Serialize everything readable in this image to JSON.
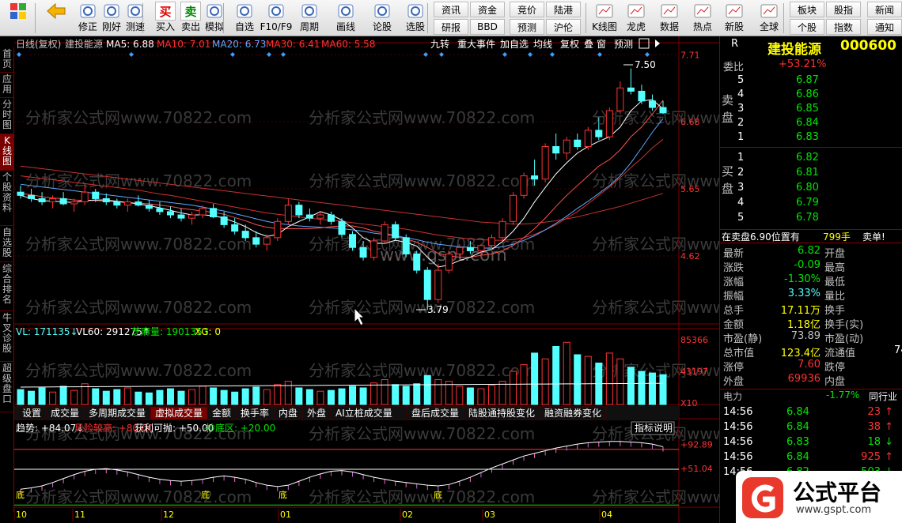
{
  "colors": {
    "up": "#ff3232",
    "down": "#54ffff",
    "white": "#ffffff",
    "yellow": "#ffff00",
    "green": "#00e600",
    "pink": "#ff66cc",
    "grid": "#800000",
    "label": "#c0c0c0",
    "title": "#ffff00"
  },
  "toolbar": [
    {
      "icon": "windows-grid-icon",
      "label": ""
    },
    {
      "icon": "back-arrow-icon",
      "label": ""
    },
    {
      "icon": "adjust-icon",
      "label": "修正"
    },
    {
      "icon": "power-icon",
      "label": "刚好"
    },
    {
      "icon": "stopwatch-icon",
      "label": "测速"
    },
    {
      "icon": "buy-icon",
      "glyph": "买",
      "label": "买入"
    },
    {
      "icon": "sell-icon",
      "glyph": "卖",
      "label": "卖出"
    },
    {
      "icon": "hammer-icon",
      "label": "模拟"
    },
    {
      "icon": "watchlist-icon",
      "label": "自选"
    },
    {
      "icon": "f10-icon",
      "label": "F10/F9"
    },
    {
      "icon": "cycle-icon",
      "label": "周期"
    },
    {
      "icon": "pen-icon",
      "label": "画线"
    },
    {
      "icon": "discuss-icon",
      "label": "论股"
    },
    {
      "icon": "select-stock-icon",
      "label": "选股"
    }
  ],
  "toolbar_grid1": [
    "资讯",
    "资金",
    "研报",
    "BBD"
  ],
  "toolbar_grid2": [
    "竞价",
    "陆港",
    "预测",
    "沪伦"
  ],
  "toolbar2": [
    {
      "icon": "kline-icon",
      "label": "K线图"
    },
    {
      "icon": "dragon-tiger-icon",
      "label": "龙虎"
    },
    {
      "icon": "pe-icon",
      "label": "数据"
    },
    {
      "icon": "hot-icon",
      "label": "热点"
    },
    {
      "icon": "new-stock-icon",
      "label": "新股"
    },
    {
      "icon": "globe-icon",
      "label": "全球"
    }
  ],
  "toolbar_grid3": [
    "板块",
    "股指",
    "个股",
    "指数"
  ],
  "toolbar_grid4": [
    "新闻",
    "通知"
  ],
  "sidebar": [
    {
      "label": "首页",
      "active": false
    },
    {
      "label": "应用",
      "active": false
    },
    {
      "label": "分时图",
      "active": false
    },
    {
      "label": "K线图",
      "active": true
    },
    {
      "label": "个股资料",
      "active": false
    },
    {
      "label": "自选股",
      "active": false
    },
    {
      "label": "综合排名",
      "active": false
    },
    {
      "label": "牛叉诊股",
      "active": false
    },
    {
      "label": "超级盘口",
      "active": false
    }
  ],
  "chart_header": {
    "period": "日线(复权)",
    "name": "建投能源",
    "ma5": "MA5: 6.88",
    "ma10": "MA10: 7.01",
    "ma20": "MA20: 6.73",
    "ma30": "MA30: 6.41",
    "ma60": "MA60: 5.58"
  },
  "chart_tools": [
    "九转",
    "重大事件",
    "加自选",
    "均线",
    "复权",
    "叠",
    "窗",
    "预测"
  ],
  "watermark": "分析家公式网www.70822.com",
  "watermark2": "www.gspt.com",
  "chart_data": [
    {
      "type": "candlestick",
      "title": "建投能源",
      "ylim": [
        3.79,
        7.71
      ],
      "y_ticks": [
        "7.71",
        "6.68",
        "5.65",
        "4.62"
      ],
      "x_ticks": [
        "10",
        "11",
        "12",
        "01",
        "02",
        "03",
        "04"
      ],
      "annotations": [
        "7.50",
        "3.79"
      ],
      "ohlc_sampled": [
        [
          5.6,
          5.7,
          5.5,
          5.55
        ],
        [
          5.55,
          5.65,
          5.45,
          5.5
        ],
        [
          5.5,
          5.6,
          5.4,
          5.45
        ],
        [
          5.45,
          5.55,
          5.35,
          5.5
        ],
        [
          5.5,
          5.6,
          5.4,
          5.42
        ],
        [
          5.42,
          5.5,
          5.3,
          5.45
        ],
        [
          5.45,
          5.7,
          5.4,
          5.6
        ],
        [
          5.6,
          5.65,
          5.45,
          5.5
        ],
        [
          5.5,
          5.58,
          5.4,
          5.45
        ],
        [
          5.45,
          5.5,
          5.35,
          5.4
        ],
        [
          5.4,
          5.5,
          5.3,
          5.45
        ],
        [
          5.45,
          5.55,
          5.38,
          5.4
        ],
        [
          5.4,
          5.48,
          5.3,
          5.35
        ],
        [
          5.35,
          5.45,
          5.25,
          5.3
        ],
        [
          5.3,
          5.38,
          5.2,
          5.25
        ],
        [
          5.25,
          5.35,
          5.15,
          5.2
        ],
        [
          5.2,
          5.3,
          5.1,
          5.25
        ],
        [
          5.25,
          5.4,
          5.2,
          5.35
        ],
        [
          5.35,
          5.42,
          5.2,
          5.22
        ],
        [
          5.22,
          5.3,
          5.05,
          5.1
        ],
        [
          5.1,
          5.2,
          4.95,
          5.0
        ],
        [
          5.0,
          5.1,
          4.85,
          4.9
        ],
        [
          4.9,
          5.0,
          4.75,
          4.8
        ],
        [
          4.8,
          4.95,
          4.7,
          4.9
        ],
        [
          4.9,
          5.2,
          4.85,
          5.15
        ],
        [
          5.15,
          5.5,
          5.1,
          5.4
        ],
        [
          5.4,
          5.45,
          5.2,
          5.25
        ],
        [
          5.25,
          5.35,
          5.15,
          5.2
        ],
        [
          5.2,
          5.3,
          5.1,
          5.25
        ],
        [
          5.25,
          5.3,
          5.1,
          5.15
        ],
        [
          5.15,
          5.2,
          4.9,
          4.95
        ],
        [
          4.95,
          5.0,
          4.7,
          4.75
        ],
        [
          4.75,
          4.85,
          4.55,
          4.6
        ],
        [
          4.6,
          4.9,
          4.55,
          4.85
        ],
        [
          4.85,
          5.15,
          4.8,
          5.1
        ],
        [
          5.1,
          5.15,
          4.85,
          4.9
        ],
        [
          4.9,
          4.95,
          4.6,
          4.65
        ],
        [
          4.65,
          4.7,
          4.35,
          4.4
        ],
        [
          4.4,
          4.45,
          3.79,
          3.95
        ],
        [
          3.95,
          4.5,
          3.9,
          4.4
        ],
        [
          4.4,
          4.7,
          4.35,
          4.65
        ],
        [
          4.65,
          4.8,
          4.55,
          4.75
        ],
        [
          4.75,
          4.85,
          4.65,
          4.7
        ],
        [
          4.7,
          4.8,
          4.6,
          4.78
        ],
        [
          4.78,
          4.95,
          4.7,
          4.9
        ],
        [
          4.9,
          5.2,
          4.85,
          5.15
        ],
        [
          5.15,
          5.6,
          5.1,
          5.55
        ],
        [
          5.55,
          5.9,
          5.5,
          5.85
        ],
        [
          5.85,
          6.1,
          5.7,
          5.8
        ],
        [
          5.8,
          6.35,
          5.75,
          6.3
        ],
        [
          6.3,
          6.5,
          6.1,
          6.2
        ],
        [
          6.2,
          6.45,
          6.1,
          6.4
        ],
        [
          6.4,
          6.5,
          6.25,
          6.3
        ],
        [
          6.3,
          6.6,
          6.25,
          6.55
        ],
        [
          6.55,
          6.75,
          6.4,
          6.45
        ],
        [
          6.45,
          6.9,
          6.4,
          6.85
        ],
        [
          6.85,
          7.3,
          6.8,
          7.2
        ],
        [
          7.2,
          7.5,
          7.1,
          7.15
        ],
        [
          7.15,
          7.25,
          6.95,
          7.0
        ],
        [
          7.0,
          7.1,
          6.85,
          6.9
        ],
        [
          6.9,
          7.0,
          6.8,
          6.82
        ]
      ],
      "ma5": [
        5.55,
        5.5,
        5.47,
        5.46,
        5.45,
        5.44,
        5.47,
        5.48,
        5.48,
        5.46,
        5.44,
        5.42,
        5.39,
        5.36,
        5.32,
        5.28,
        5.25,
        5.25,
        5.24,
        5.2,
        5.14,
        5.07,
        4.98,
        4.92,
        4.95,
        5.07,
        5.15,
        5.22,
        5.3,
        5.25,
        5.17,
        5.05,
        4.9,
        4.82,
        4.81,
        4.86,
        4.83,
        4.77,
        4.6,
        4.45,
        4.48,
        4.55,
        4.6,
        4.68,
        4.72,
        4.84,
        5.0,
        5.2,
        5.45,
        5.67,
        5.88,
        6.05,
        6.2,
        6.3,
        6.38,
        6.45,
        6.6,
        6.85,
        7.0,
        7.02,
        6.88
      ],
      "ma10": [
        5.58,
        5.56,
        5.53,
        5.51,
        5.5,
        5.48,
        5.47,
        5.47,
        5.46,
        5.45,
        5.44,
        5.43,
        5.42,
        5.4,
        5.38,
        5.35,
        5.33,
        5.31,
        5.29,
        5.26,
        5.21,
        5.16,
        5.1,
        5.06,
        5.04,
        5.04,
        5.04,
        5.04,
        5.05,
        5.07,
        5.08,
        5.08,
        5.05,
        5.0,
        4.97,
        4.93,
        4.88,
        4.83,
        4.75,
        4.66,
        4.62,
        4.6,
        4.6,
        4.63,
        4.65,
        4.7,
        4.78,
        4.9,
        5.04,
        5.2,
        5.38,
        5.55,
        5.7,
        5.85,
        6.0,
        6.1,
        6.25,
        6.45,
        6.6,
        6.8,
        7.01
      ],
      "ma20": [
        5.72,
        5.7,
        5.68,
        5.66,
        5.64,
        5.62,
        5.6,
        5.58,
        5.56,
        5.54,
        5.52,
        5.5,
        5.48,
        5.46,
        5.44,
        5.42,
        5.4,
        5.37,
        5.34,
        5.31,
        5.27,
        5.23,
        5.19,
        5.15,
        5.12,
        5.1,
        5.08,
        5.07,
        5.06,
        5.05,
        5.04,
        5.02,
        5.0,
        4.97,
        4.95,
        4.93,
        4.9,
        4.87,
        4.83,
        4.8,
        4.78,
        4.76,
        4.75,
        4.74,
        4.74,
        4.76,
        4.8,
        4.86,
        4.93,
        5.02,
        5.12,
        5.23,
        5.35,
        5.46,
        5.58,
        5.7,
        5.85,
        6.05,
        6.28,
        6.52,
        6.73
      ],
      "ma30": [
        5.85,
        5.83,
        5.81,
        5.79,
        5.77,
        5.75,
        5.73,
        5.71,
        5.69,
        5.67,
        5.65,
        5.63,
        5.6,
        5.57,
        5.55,
        5.52,
        5.49,
        5.46,
        5.43,
        5.4,
        5.37,
        5.34,
        5.31,
        5.28,
        5.26,
        5.24,
        5.22,
        5.2,
        5.18,
        5.17,
        5.15,
        5.13,
        5.11,
        5.09,
        5.07,
        5.05,
        5.03,
        5.0,
        4.97,
        4.94,
        4.92,
        4.9,
        4.88,
        4.87,
        4.86,
        4.86,
        4.87,
        4.9,
        4.95,
        5.02,
        5.1,
        5.2,
        5.3,
        5.42,
        5.55,
        5.68,
        5.82,
        5.98,
        6.12,
        6.28,
        6.41
      ],
      "ma60": [
        6.0,
        5.98,
        5.96,
        5.94,
        5.92,
        5.9,
        5.88,
        5.86,
        5.84,
        5.82,
        5.8,
        5.78,
        5.76,
        5.74,
        5.72,
        5.7,
        5.68,
        5.66,
        5.64,
        5.62,
        5.6,
        5.58,
        5.56,
        5.54,
        5.52,
        5.5,
        5.48,
        5.46,
        5.44,
        5.42,
        5.4,
        5.38,
        5.36,
        5.34,
        5.32,
        5.3,
        5.28,
        5.26,
        5.24,
        5.22,
        5.2,
        5.18,
        5.16,
        5.14,
        5.13,
        5.12,
        5.11,
        5.11,
        5.12,
        5.14,
        5.16,
        5.19,
        5.22,
        5.26,
        5.3,
        5.34,
        5.38,
        5.43,
        5.48,
        5.53,
        5.58
      ]
    },
    {
      "type": "bar",
      "title": "VL",
      "ylim": [
        0,
        85366
      ],
      "y_ticks": [
        "85366",
        "43197",
        "X10"
      ],
      "legend": [
        "VL: 171135↓",
        "VL60: 291275↑",
        "芝麻量: 190135↑",
        "XG: 0"
      ],
      "values": [
        18,
        16,
        20,
        15,
        22,
        17,
        25,
        19,
        16,
        18,
        20,
        15,
        14,
        17,
        19,
        16,
        18,
        22,
        20,
        17,
        15,
        19,
        21,
        18,
        24,
        28,
        20,
        18,
        16,
        17,
        19,
        22,
        20,
        26,
        30,
        24,
        22,
        25,
        35,
        30,
        28,
        22,
        20,
        19,
        23,
        28,
        40,
        48,
        62,
        55,
        70,
        75,
        60,
        58,
        50,
        62,
        55,
        45,
        40,
        38,
        36
      ]
    },
    {
      "type": "line",
      "title": "趋势抄底指标",
      "legend": [
        "趋势: +84.07↓",
        "风险较高: +80.00",
        "获利可抛: +50.00",
        "抄底区: +20.00"
      ],
      "y_ticks": [
        "+92.89",
        "+51.04"
      ],
      "values": [
        20,
        22,
        25,
        30,
        36,
        42,
        47,
        50,
        51,
        49,
        46,
        42,
        38,
        35,
        33,
        32,
        33,
        35,
        38,
        40,
        38,
        35,
        30,
        26,
        24,
        26,
        32,
        38,
        43,
        47,
        48,
        46,
        42,
        38,
        35,
        32,
        30,
        28,
        26,
        25,
        27,
        32,
        38,
        45,
        52,
        58,
        64,
        70,
        74,
        78,
        82,
        85,
        88,
        90,
        91,
        92,
        92,
        91,
        90,
        88,
        84
      ]
    }
  ],
  "indicator_tabs": [
    "设置",
    "成交量",
    "多周期成交量",
    "虚拟成交量",
    "金额",
    "换手率",
    "内盘",
    "外盘",
    "AI立桩成交量",
    "盘后成交量",
    "陆股通持股变化",
    "融资融券变化"
  ],
  "indicator_tab_active": 3,
  "indicator_help": "指标说明",
  "bottom_labels": [
    "底",
    "底",
    "底",
    "底"
  ],
  "quote": {
    "header_r": "R",
    "name": "建投能源",
    "code": "000600",
    "weibi_label": "委比",
    "weibi": "+53.21%",
    "sell_label": "卖盘",
    "buy_label": "买盘",
    "sell": [
      {
        "lvl": "5",
        "price": "6.87"
      },
      {
        "lvl": "4",
        "price": "6.86"
      },
      {
        "lvl": "3",
        "price": "6.85"
      },
      {
        "lvl": "2",
        "price": "6.84"
      },
      {
        "lvl": "1",
        "price": "6.83"
      }
    ],
    "buy": [
      {
        "lvl": "1",
        "price": "6.82"
      },
      {
        "lvl": "2",
        "price": "6.81"
      },
      {
        "lvl": "3",
        "price": "6.80"
      },
      {
        "lvl": "4",
        "price": "6.79"
      },
      {
        "lvl": "5",
        "price": "6.78"
      }
    ],
    "bar_text": "在卖盘6.90位置有",
    "bar_val": "799手",
    "bar_sell": "卖单!",
    "stats": [
      [
        "最新",
        "6.82",
        "开盘",
        ""
      ],
      [
        "涨跌",
        "-0.09",
        "最高",
        ""
      ],
      [
        "涨幅",
        "-1.30%",
        "最低",
        ""
      ],
      [
        "振幅",
        "3.33%",
        "量比",
        ""
      ],
      [
        "总手",
        "17.11万",
        "换手",
        ""
      ],
      [
        "金额",
        "1.18亿",
        "换手(实)",
        ""
      ],
      [
        "市盈(静)",
        "73.89",
        "市盈(动)",
        ""
      ],
      [
        "总市值",
        "123.4亿",
        "流通值",
        "74"
      ],
      [
        "涨停",
        "7.60",
        "跌停",
        ""
      ],
      [
        "外盘",
        "69936",
        "内盘",
        ""
      ]
    ],
    "sector": "电力",
    "sector_chg": "-1.77%",
    "sector_more": "同行业",
    "ticks": [
      {
        "time": "14:56",
        "price": "6.84",
        "vol": "23",
        "dir": "up"
      },
      {
        "time": "14:56",
        "price": "6.84",
        "vol": "38",
        "dir": "up"
      },
      {
        "time": "14:56",
        "price": "6.83",
        "vol": "18",
        "dir": "down"
      },
      {
        "time": "14:56",
        "price": "6.84",
        "vol": "925",
        "dir": "up"
      },
      {
        "time": "14:56",
        "price": "6.82",
        "vol": "503",
        "dir": "down"
      }
    ]
  },
  "logo": {
    "text": "公式平台",
    "url": "www.gspt.com"
  }
}
